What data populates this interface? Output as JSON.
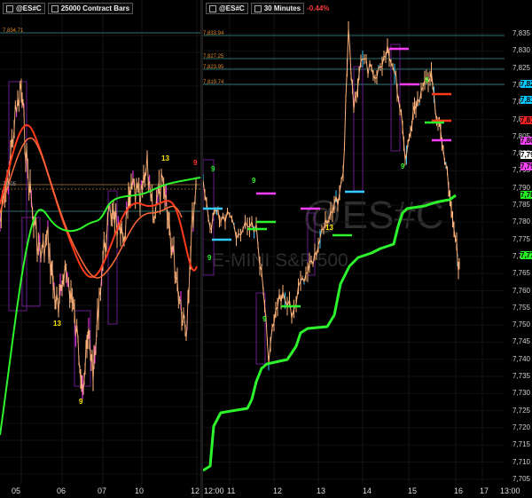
{
  "left_chart": {
    "symbol": "@ES#C",
    "bar_type": "25000 Contract Bars",
    "level_label": "7,834.71",
    "mid_label": "7,805",
    "x_ticks": [
      "05",
      "06",
      "07",
      "10",
      "12"
    ],
    "count_labels": [
      "13",
      "9",
      "13",
      "9"
    ]
  },
  "right_chart": {
    "symbol": "@ES#C",
    "interval": "30 Minutes",
    "change": "-0.44%",
    "watermark_symbol": "@ES#C",
    "watermark_name": "E-MINI S&P 500",
    "level_labels": [
      "7,833.94",
      "7,827.25",
      "7,823.95",
      "7,819.74"
    ],
    "x_ticks": [
      "12:00",
      "11",
      "12",
      "13",
      "14",
      "15",
      "16",
      "17",
      "18",
      "13:00"
    ],
    "y_ticks": [
      "7,835",
      "7,830",
      "7,825",
      "7,820",
      "7,815",
      "7,810",
      "7,805",
      "7,800",
      "7,795",
      "7,790",
      "7,785",
      "7,780",
      "7,775",
      "7,770",
      "7,765",
      "7,760",
      "7,755",
      "7,750",
      "7,745",
      "7,740",
      "7,735",
      "7,730",
      "7,725",
      "7,720",
      "7,715",
      "7,710",
      "7,705"
    ],
    "price_tags": [
      {
        "text": "7,820",
        "color": "#00c8ff"
      },
      {
        "text": "7,815",
        "color": "#00c8ff"
      },
      {
        "text": "7,810",
        "color": "#ff2020"
      },
      {
        "text": "7,800",
        "color": "#ff44ff"
      },
      {
        "text": "7,795",
        "color": "#ffffff"
      },
      {
        "text": "7,790",
        "color": "#ff44ff"
      },
      {
        "text": "7,785",
        "color": "#22ee22"
      },
      {
        "text": "7,770",
        "color": "#22ee22"
      }
    ],
    "count_labels": [
      "9",
      "9",
      "9",
      "9",
      "9",
      "9"
    ],
    "count_13": "13"
  },
  "colors": {
    "background": "#000000",
    "green_line": "#2cf52c",
    "red_line": "#ff3a1a",
    "price": "#ffb37a",
    "magenta": "#ff3cff",
    "cyan": "#33ccff",
    "level_teal": "#2b6f6f"
  }
}
